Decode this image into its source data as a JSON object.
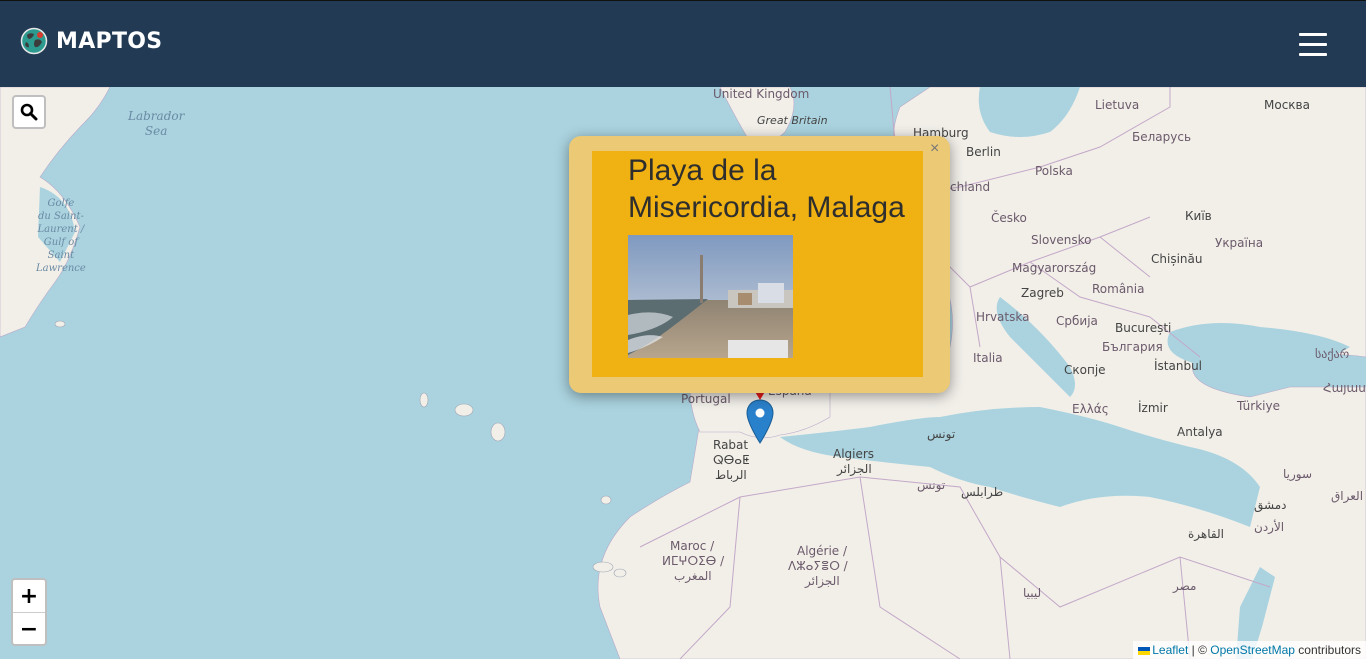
{
  "app": {
    "brand": "MAPTOS",
    "logo_icon": "globe-icon",
    "menu_icon": "hamburger-menu-icon"
  },
  "colors": {
    "navbar": "#223a54",
    "sea": "#aad3df",
    "land": "#f2efe9",
    "popup_outer": "#ebc975",
    "popup_inner": "#f0b112",
    "marker_blue": "#2a81cb",
    "marker_red": "#e61c1c"
  },
  "map_controls": {
    "search_icon": "search-icon",
    "zoom_in": "+",
    "zoom_out": "−"
  },
  "popup": {
    "title": "Playa de la Misericordia, Malaga",
    "close": "×",
    "image_icon": "beach-photo"
  },
  "attribution": {
    "leaflet": "Leaflet",
    "separator": " | © ",
    "osm": "OpenStreetMap",
    "suffix": " contributors"
  },
  "labels": {
    "labrador_sea": "Labrador\nSea",
    "gulf_st_lawrence": "Golfe\ndu Saint-\nLaurent /\nGulf of\nSaint\nLawrence",
    "united_kingdom": "United Kingdom",
    "great_britain": "Great Britain",
    "hamburg": "Hamburg",
    "berlin": "Berlin",
    "lietuva": "Lietuva",
    "moskva": "Москва",
    "belarus": "Беларусь",
    "polska": "Polska",
    "deutschland": "chland",
    "cesko": "Česko",
    "kyiv": "Київ",
    "ukraina": "Україна",
    "slovensko": "Slovensko",
    "chisinau": "Chișinău",
    "magyarorszag": "Magyarország",
    "zagreb": "Zagreb",
    "romania": "România",
    "hrvatska": "Hrvatska",
    "srbija": "Србија",
    "bucuresti": "București",
    "bulgaria": "България",
    "italia": "Italia",
    "skopje": "Скопје",
    "istanbul": "İstanbul",
    "georgia": "საქარ",
    "armenia": "Հայաս",
    "ellas": "Ελλάς",
    "izmir": "İzmir",
    "turkiye": "Türkiye",
    "antalya": "Antalya",
    "portugal": "Portugal",
    "espana": "España",
    "rabat": "Rabat",
    "rabat_tif": "ⵕⴱⴰⵟ",
    "rabat_ar": "الرباط",
    "algiers": "Algiers",
    "algiers_ar": "الجزائر",
    "tunis": "تونس",
    "tunisia": "تونس",
    "tripoli": "طرابلس",
    "maroc": "Maroc /",
    "maroc_tif": "ⵍⵎⵖⵔⵉⴱ /",
    "maroc_ar": "المغرب",
    "algerie": "Algérie /",
    "algerie_tif": "ⴷⵣⴰⵢⴻⵔ /",
    "algerie_ar": "الجزائر",
    "libya": "ليبيا",
    "cairo": "القاهرة",
    "misr": "مصر",
    "syria": "سوريا",
    "dimashq": "دمشق",
    "iraq": "العراق",
    "jordan": "الأردن"
  }
}
